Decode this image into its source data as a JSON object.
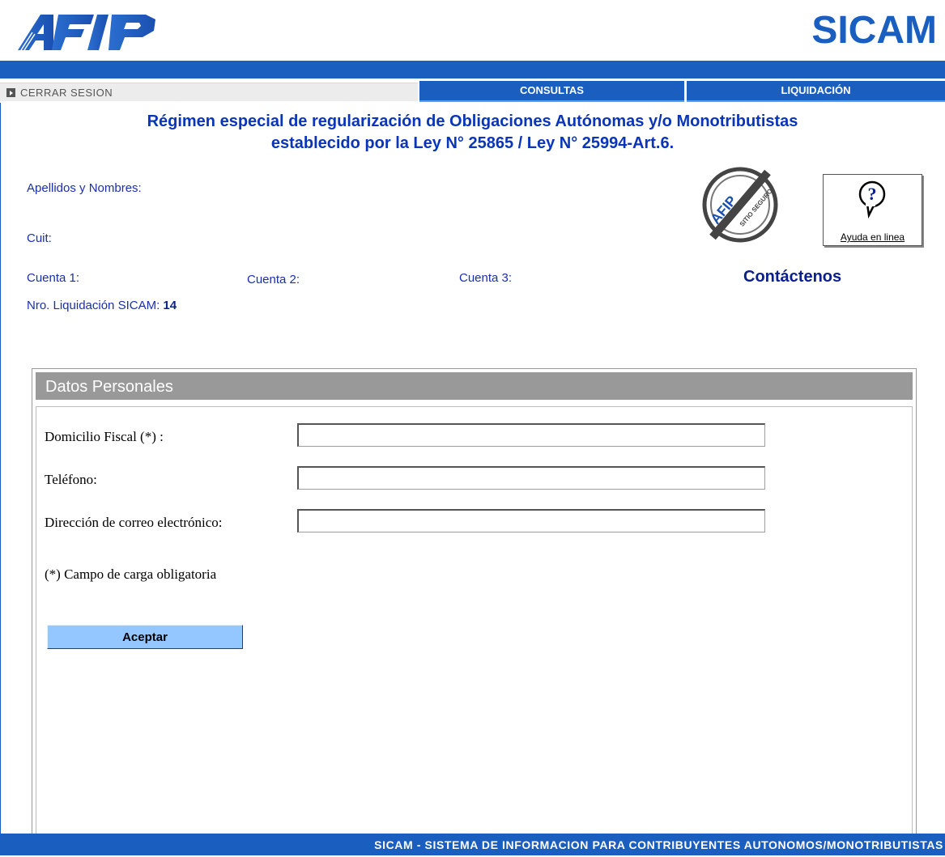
{
  "header": {
    "logo_text": "AFIP",
    "app_title": "SICAM"
  },
  "nav": {
    "logout": "CERRAR SESION",
    "tabs": [
      {
        "label": "CONSULTAS"
      },
      {
        "label": "LIQUIDACIÓN"
      }
    ]
  },
  "page": {
    "title_line1": "Régimen especial de regularización de Obligaciones Autónomas y/o Monotributistas",
    "title_line2": "establecido por la Ley N° 25865 / Ley N° 25994-Art.6."
  },
  "info": {
    "names_label": "Apellidos y Nombres:",
    "cuit_label": "Cuit:",
    "cuenta1_label": "Cuenta 1:",
    "cuenta2_label": "Cuenta 2:",
    "cuenta3_label": "Cuenta 3:",
    "liquidacion_label": "Nro. Liquidación SICAM:",
    "liquidacion_value": "14"
  },
  "seal": {
    "text_top": "AFIP",
    "text_bottom": "SITIO SEGURO"
  },
  "help": {
    "label": "Ayuda en linea",
    "icon": "question-bubble-icon"
  },
  "contact_label": "Contáctenos",
  "form": {
    "section_title": "Datos Personales",
    "fields": [
      {
        "label": "Domicilio Fiscal (*) :",
        "value": ""
      },
      {
        "label": "Teléfono:",
        "value": ""
      },
      {
        "label": "Dirección de correo electrónico:",
        "value": ""
      }
    ],
    "required_note": "(*) Campo de carga obligatoria",
    "submit_label": "Aceptar"
  },
  "footer": {
    "text": "SICAM - SISTEMA DE INFORMACION PARA CONTRIBUYENTES AUTONOMOS/MONOTRIBUTISTAS"
  },
  "colors": {
    "brand_blue": "#1a5fbf",
    "title_blue": "#0a35b8",
    "panel_header_gray": "#999999",
    "button_blue": "#94c6ff"
  }
}
